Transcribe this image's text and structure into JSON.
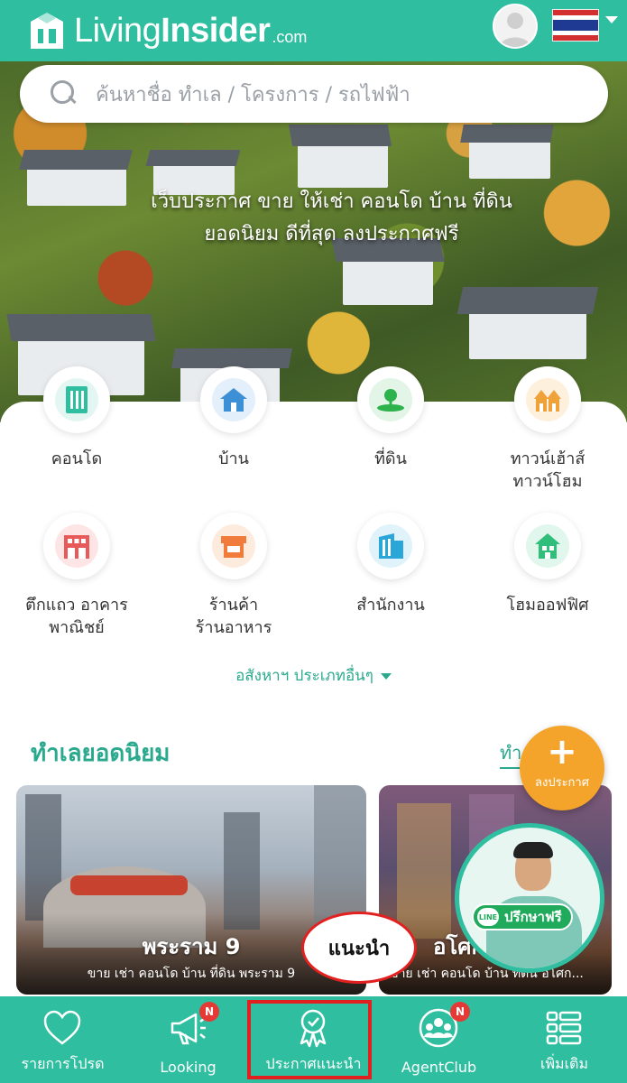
{
  "header": {
    "logo_main": "Living",
    "logo_bold": "Insider",
    "logo_domain": ".com"
  },
  "search": {
    "placeholder": "ค้นหาชื่อ ทำเล / โครงการ / รถไฟฟ้า"
  },
  "hero": {
    "line1": "เว็บประกาศ ขาย ให้เช่า คอนโด บ้าน ที่ดิน",
    "line2": "ยอดนิยม ดีที่สุด ลงประกาศฟรี"
  },
  "categories": [
    {
      "line1": "คอนโด",
      "line2": "",
      "icon": "condo-icon",
      "color": "#2fbfa0",
      "bg": "#e3f6f1"
    },
    {
      "line1": "บ้าน",
      "line2": "",
      "icon": "house-icon",
      "color": "#3d8fd6",
      "bg": "#e3effa"
    },
    {
      "line1": "ที่ดิน",
      "line2": "",
      "icon": "land-icon",
      "color": "#2eb24b",
      "bg": "#e2f5e6"
    },
    {
      "line1": "ทาวน์เฮ้าส์",
      "line2": "ทาวน์โฮม",
      "icon": "townhouse-icon",
      "color": "#f0a23a",
      "bg": "#fdf0dd"
    },
    {
      "line1": "ตึกแถว อาคาร",
      "line2": "พาณิชย์",
      "icon": "shophouse-icon",
      "color": "#e85a5a",
      "bg": "#fde5e5"
    },
    {
      "line1": "ร้านค้า",
      "line2": "ร้านอาหาร",
      "icon": "shop-icon",
      "color": "#f07b3a",
      "bg": "#fdebde"
    },
    {
      "line1": "สำนักงาน",
      "line2": "",
      "icon": "office-icon",
      "color": "#2aa6d8",
      "bg": "#e0f2fa"
    },
    {
      "line1": "โฮมออฟฟิศ",
      "line2": "",
      "icon": "home-office-icon",
      "color": "#2fbf7a",
      "bg": "#e1f6ec"
    }
  ],
  "more_types": "อสังหาฯ ประเภทอื่นๆ",
  "popular": {
    "title": "ทำเลยอดนิยม",
    "link": "ทำ"
  },
  "fab": {
    "plus": "+",
    "label": "ลงประกาศ"
  },
  "cards": [
    {
      "title": "พระราม 9",
      "subtitle": "ขาย เช่า คอนโด บ้าน ที่ดิน พระราม 9"
    },
    {
      "title": "อโศก",
      "subtitle": "ขาย เช่า คอนโด บ้าน ที่ดิน อโศก..."
    }
  ],
  "annotation": "แนะนำ",
  "consult": {
    "line_badge": "LINE",
    "label": "ปรึกษาฟรี"
  },
  "bottom_nav": [
    {
      "label": "รายการโปรด",
      "icon": "heart-icon",
      "badge": ""
    },
    {
      "label": "Looking",
      "icon": "megaphone-icon",
      "badge": "N"
    },
    {
      "label": "ประกาศแนะนำ",
      "icon": "award-icon",
      "badge": ""
    },
    {
      "label": "AgentClub",
      "icon": "agent-club-icon",
      "badge": "N"
    },
    {
      "label": "เพิ่มเติม",
      "icon": "menu-grid-icon",
      "badge": ""
    }
  ],
  "colors": {
    "brand": "#2fbfa0",
    "accent": "#f4a42a",
    "annotation": "#e32020"
  }
}
